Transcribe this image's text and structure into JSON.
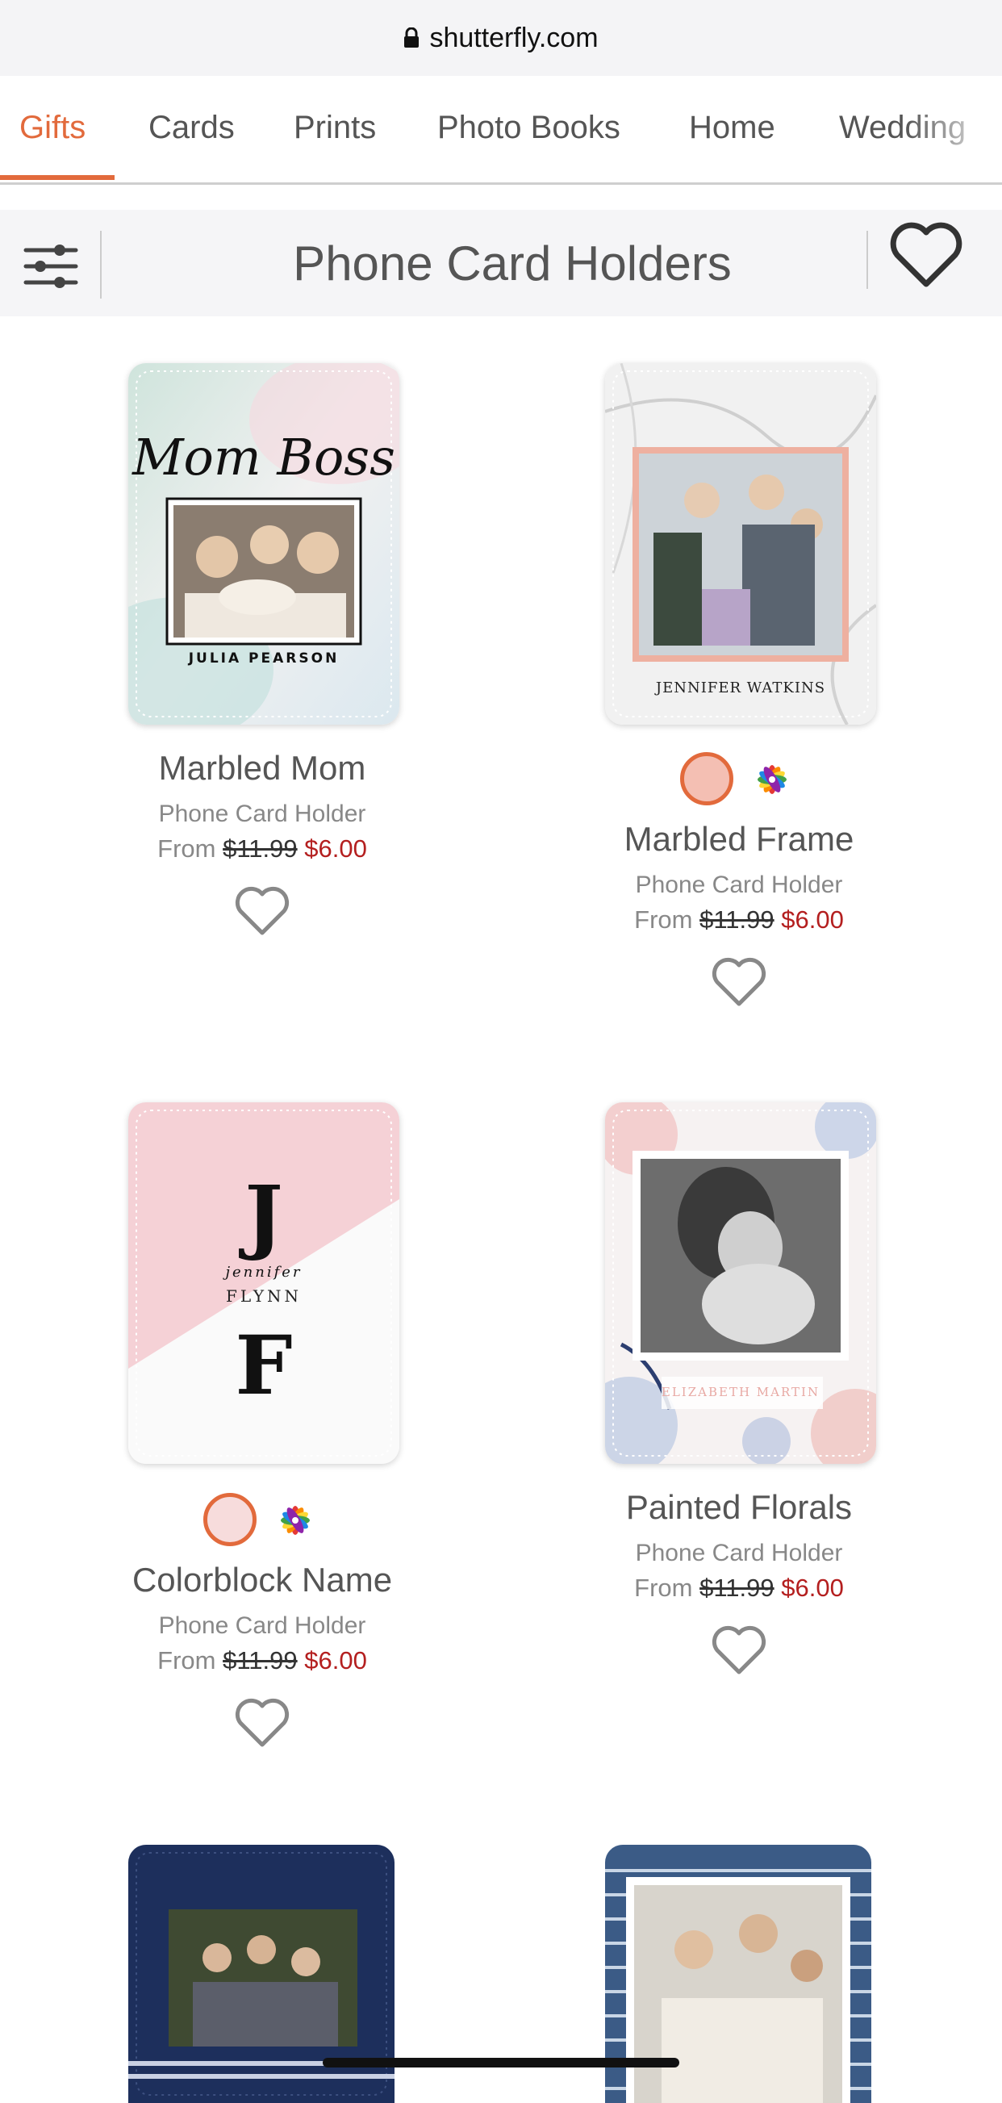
{
  "browser": {
    "url": "shutterfly.com"
  },
  "nav": {
    "tabs": [
      {
        "label": "Gifts",
        "active": true
      },
      {
        "label": "Cards"
      },
      {
        "label": "Prints"
      },
      {
        "label": "Photo Books"
      },
      {
        "label": "Home"
      },
      {
        "label": "Wedding"
      }
    ]
  },
  "header": {
    "title": "Phone Card Holders"
  },
  "products": [
    {
      "name": "Marbled Mom",
      "type": "Phone Card Holder",
      "from": "From",
      "old_price": "$11.99",
      "price": "$6.00",
      "art": {
        "script": "Mom Boss",
        "caption": "JULIA PEARSON"
      }
    },
    {
      "name": "Marbled Frame",
      "type": "Phone Card Holder",
      "from": "From",
      "old_price": "$11.99",
      "price": "$6.00",
      "art": {
        "caption": "JENNIFER WATKINS"
      }
    },
    {
      "name": "Colorblock Name",
      "type": "Phone Card Holder",
      "from": "From",
      "old_price": "$11.99",
      "price": "$6.00",
      "art": {
        "initial_top": "J",
        "first": "jennifer",
        "last": "FLYNN",
        "initial_bottom": "F"
      }
    },
    {
      "name": "Painted Florals",
      "type": "Phone Card Holder",
      "from": "From",
      "old_price": "$11.99",
      "price": "$6.00",
      "art": {
        "caption": "ELIZABETH MARTIN"
      }
    }
  ],
  "colors": {
    "accent": "#e26a3c",
    "sale": "#b41f1f",
    "swatch_pink": "#f4bfb3"
  }
}
